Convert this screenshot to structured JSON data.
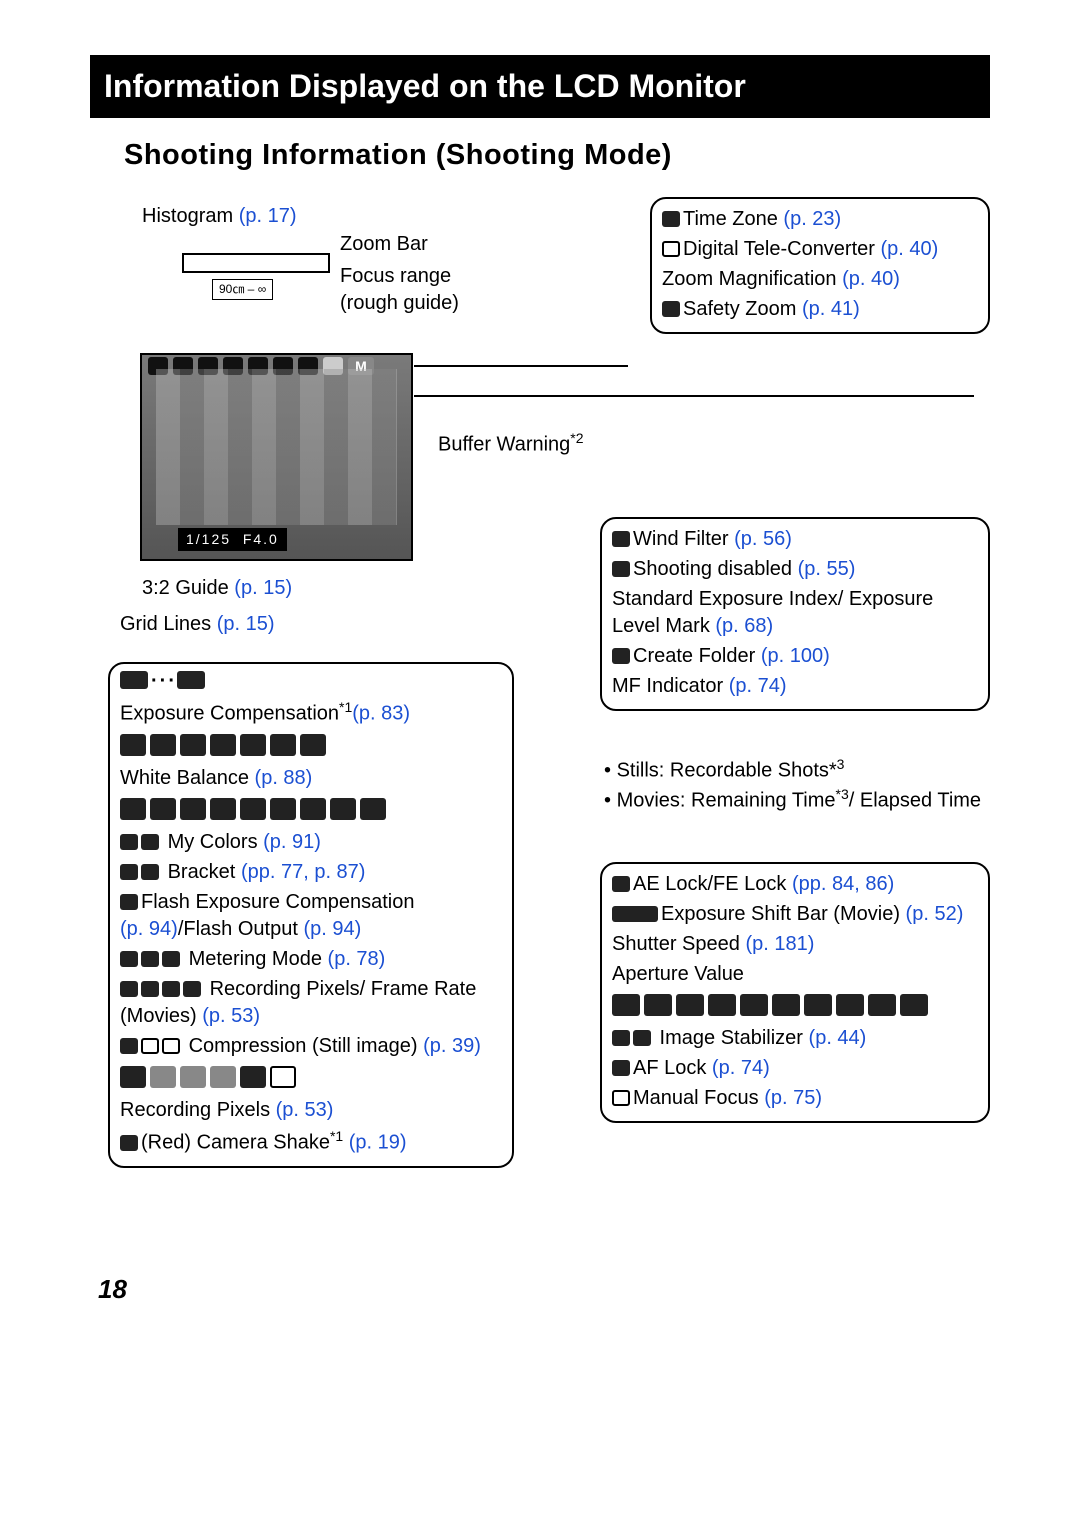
{
  "title": "Information Displayed on the LCD Monitor",
  "subtitle": "Shooting Information (Shooting Mode)",
  "page_number": "18",
  "lcd": {
    "shutter": "1/125",
    "aperture": "F4.0"
  },
  "top_labels": {
    "histogram": "Histogram",
    "histogram_ref": "(p. 17)",
    "zoom_bar": "Zoom Bar",
    "focus_range1": "Focus range",
    "focus_range2": "(rough guide)",
    "zoom_range_text": "90㎝ – ∞"
  },
  "buffer_warning": {
    "text": "Buffer Warning",
    "note": "*2"
  },
  "guide_line": {
    "text": "3:2 Guide",
    "ref": "(p. 15)"
  },
  "grid_line": {
    "text": "Grid Lines",
    "ref": "(p. 15)"
  },
  "right_top": [
    {
      "label": "Time Zone",
      "ref": "(p. 23)",
      "icon": true
    },
    {
      "label": "Digital Tele-Converter",
      "ref": "(p. 40)",
      "icon": true
    },
    {
      "label": "Zoom Magnification",
      "ref": "(p. 40)",
      "icon": false
    },
    {
      "label": "Safety Zoom",
      "ref": "(p. 41)",
      "icon": true
    }
  ],
  "right_mid": [
    {
      "label": "Wind Filter",
      "ref": "(p. 56)",
      "icon": true
    },
    {
      "label": "Shooting disabled",
      "ref": "(p. 55)",
      "icon": true
    },
    {
      "label": "Standard Exposure Index/ Exposure Level Mark",
      "ref": "(p. 68)",
      "icon": false
    },
    {
      "label": "Create Folder",
      "ref": "(p. 100)",
      "icon": true
    },
    {
      "label": "MF Indicator",
      "ref": "(p. 74)",
      "icon": false
    }
  ],
  "right_bullets": {
    "b1": "Stills: Recordable Shots*",
    "b1n": "3",
    "b2a": "Movies: Remaining Time",
    "b2n": "*3",
    "b2b": "/ Elapsed Time"
  },
  "right_low": [
    {
      "label": "AE Lock/FE Lock",
      "ref": "(pp. 84, 86)",
      "icon": true
    },
    {
      "label": "Exposure Shift Bar (Movie)",
      "ref": "(p. 52)",
      "icon": true
    },
    {
      "label": "Shutter Speed",
      "ref": "(p. 181)",
      "icon": false
    },
    {
      "label": "Aperture Value",
      "ref": "",
      "icon": false
    },
    {
      "iconrow": 12
    },
    {
      "label": " Image Stabilizer",
      "ref": "(p. 44)",
      "icon_pair": true
    },
    {
      "label": "AF Lock",
      "ref": "(p. 74)",
      "icon": true
    },
    {
      "label": "Manual Focus",
      "ref": "(p. 75)",
      "icon": true
    }
  ],
  "left_box": {
    "exp_comp_icons": "–2 ··· +2",
    "exp_comp": "Exposure Compensation",
    "exp_comp_note": "*1",
    "exp_comp_ref": "(p. 83)",
    "wb": "White Balance",
    "wb_ref": "(p. 88)",
    "mycolors": "My Colors",
    "mycolors_ref": "(p. 91)",
    "bracket": "Bracket",
    "bracket_ref": "(pp. 77, p. 87)",
    "flash_exp": "Flash Exposure Compensation",
    "flash_exp_ref1": "(p. 94)",
    "flash_exp_mid": "/Flash Output",
    "flash_exp_ref2": "(p. 94)",
    "metering": "Metering Mode",
    "metering_ref": "(p. 78)",
    "recpix_mov": "Recording Pixels/ Frame Rate (Movies)",
    "recpix_mov_ref": "(p. 53)",
    "compression": "Compression (Still image)",
    "compression_ref": "(p. 39)",
    "recpix": "Recording Pixels",
    "recpix_ref": "(p. 53)",
    "shake": "(Red) Camera Shake",
    "shake_note": "*1",
    "shake_ref": "(p. 19)"
  }
}
